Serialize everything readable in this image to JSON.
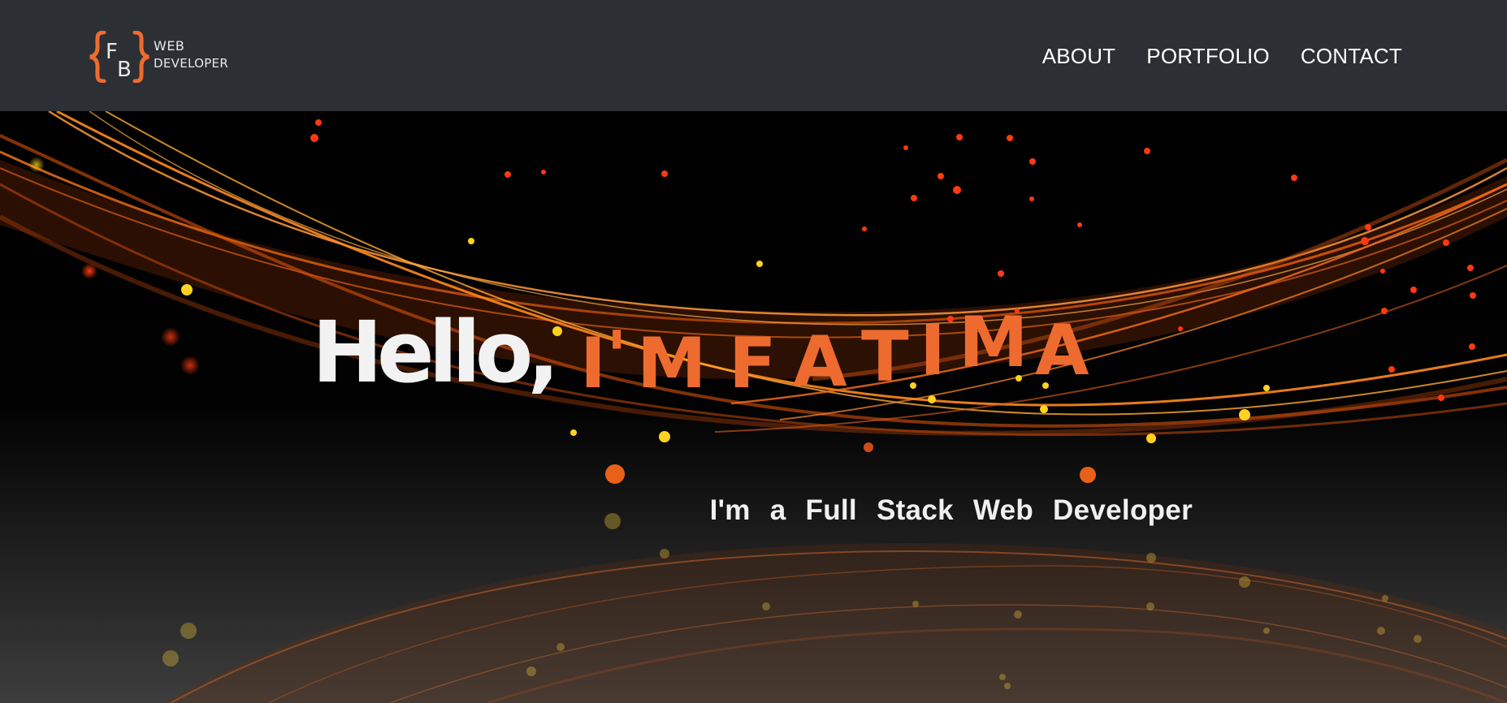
{
  "header": {
    "logo": {
      "monogram": "FB",
      "line1": "WEB",
      "line2": "DEVELOPER"
    },
    "nav": [
      {
        "label": "ABOUT"
      },
      {
        "label": "PORTFOLIO"
      },
      {
        "label": "CONTACT"
      }
    ]
  },
  "hero": {
    "greeting": "Hello,",
    "name_letters": [
      "I",
      "'",
      "M",
      "F",
      "A",
      "T",
      "I",
      "M",
      "A"
    ],
    "subtitle": "I'm a Full Stack Web Developer"
  },
  "colors": {
    "accent": "#ee6b30",
    "navbar_bg": "#2c2f33",
    "text": "#ffffff"
  }
}
